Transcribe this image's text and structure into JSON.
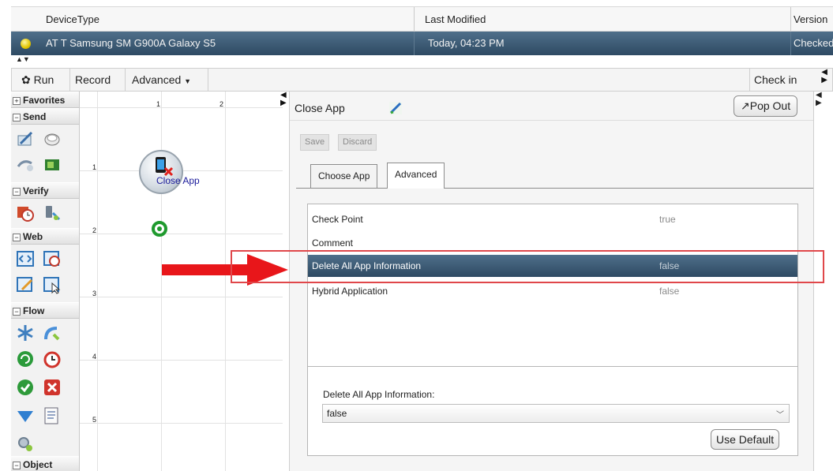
{
  "device_table": {
    "headers": [
      "DeviceType",
      "Last Modified",
      "Version"
    ],
    "row": {
      "device_type": "AT T Samsung SM G900A Galaxy S5",
      "last_modified": "Today, 04:23 PM",
      "version": "Checked"
    },
    "status_color": "#e2c400"
  },
  "toolbar": {
    "run_label": "Run",
    "record_label": "Record",
    "advanced_label": "Advanced",
    "checkin_label": "Check in"
  },
  "palette": {
    "categories": [
      {
        "label": "Favorites",
        "expanded": false
      },
      {
        "label": "Send",
        "expanded": true
      },
      {
        "label": "Verify",
        "expanded": true
      },
      {
        "label": "Web",
        "expanded": true
      },
      {
        "label": "Flow",
        "expanded": true
      },
      {
        "label": "Object",
        "expanded": true
      }
    ]
  },
  "canvas": {
    "col_numbers": [
      "1",
      "2"
    ],
    "row_numbers": [
      "1",
      "2",
      "3",
      "4",
      "5"
    ],
    "node_label": "Close App"
  },
  "properties": {
    "title": "Close App",
    "popout_label": "Pop Out",
    "save_label": "Save",
    "discard_label": "Discard",
    "tabs": [
      "Choose App",
      "Advanced"
    ],
    "active_tab": "Advanced",
    "rows": [
      {
        "name": "Check Point",
        "value": "true"
      },
      {
        "name": "Comment",
        "value": ""
      },
      {
        "name": "Delete All App Information",
        "value": "false",
        "selected": true
      },
      {
        "name": "Hybrid Application",
        "value": "false"
      }
    ],
    "edit_label": "Delete All App Information:",
    "edit_value": "false",
    "use_default_label": "Use Default"
  },
  "colors": {
    "selection": "#3c5a74",
    "highlight_box": "#e0474a",
    "arrow": "#e8161a"
  }
}
